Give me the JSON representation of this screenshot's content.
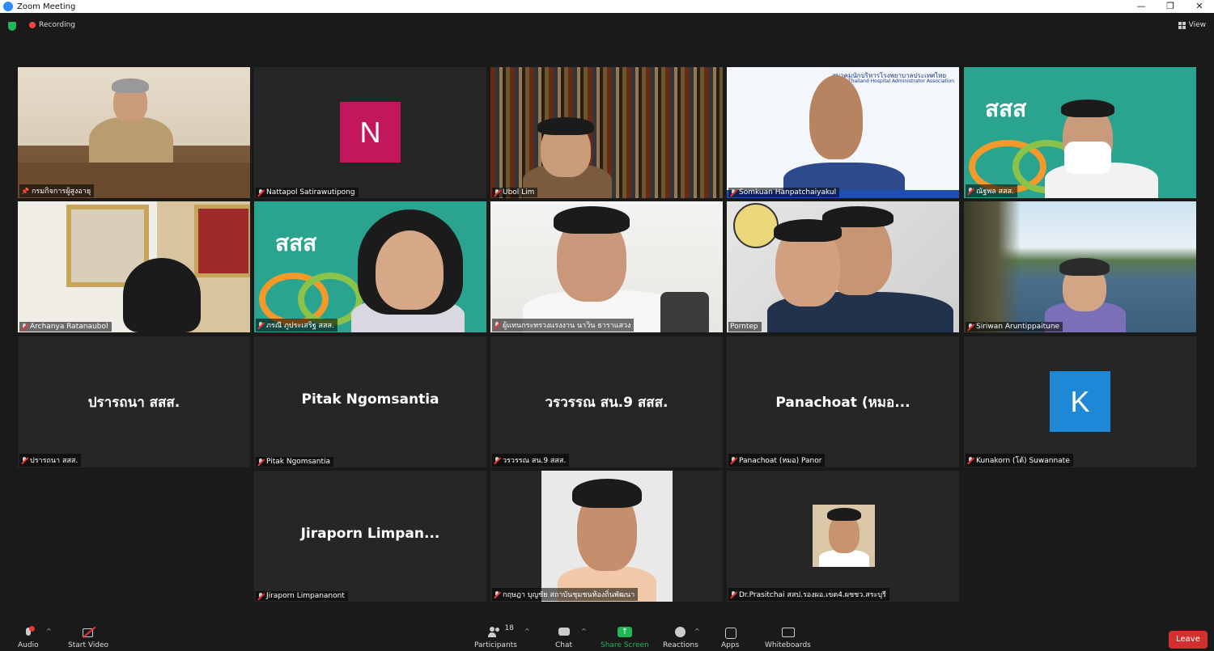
{
  "window": {
    "title": "Zoom Meeting",
    "minimize": "—",
    "restore": "❐",
    "close": "✕"
  },
  "topbar": {
    "recording": "Recording",
    "view": "View"
  },
  "tiles": [
    {
      "name": "กรมกิจการผู้สูงอายุ",
      "pinned": true
    },
    {
      "name": "Nattapol Satirawutipong",
      "initial": "N",
      "avatar_color": "#c2185b"
    },
    {
      "name": "Ubol Lim"
    },
    {
      "name": "Somkuan Hanpatchaiyakul",
      "bg_text": "สมาคมนักบริหารโรงพยาบาลประเทศไทย",
      "bg_text_en": "Thailand Hospital Administrator Association"
    },
    {
      "name": "ณัฐพล สสส.",
      "logo": "สสส"
    },
    {
      "name": "Archanya Ratanaubol"
    },
    {
      "name": "ภรณี ภูประเสริฐ สสส.",
      "logo": "สสส"
    },
    {
      "name": "ผู้แทนกระทรวงแรงงาน นาวิน ธาราแสวง"
    },
    {
      "name": "Porntep",
      "speaking": true
    },
    {
      "name": "Siriwan Aruntippaitune"
    },
    {
      "name": "ปรารถนา สสส.",
      "display": "ปรารถนา สสส."
    },
    {
      "name": "Pitak Ngomsantia",
      "display": "Pitak Ngomsantia"
    },
    {
      "name": "วรวรรณ สน.9 สสส.",
      "display": "วรวรรณ สน.9 สสส."
    },
    {
      "name": "Panachoat (หมอ) Panor",
      "display": "Panachoat  (หมอ..."
    },
    {
      "name": "Kunakorn (โต้) Suwannate",
      "initial": "K",
      "avatar_color": "#1e88d6"
    },
    {
      "name": "Jiraporn Limpananont",
      "display": "Jiraporn  Limpan..."
    },
    {
      "name": "กฤษฎา บุญชัย สถาบันชุมชนท้องถิ่นพัฒนา"
    },
    {
      "name": "Dr.Prasitchai สสป.รองผอ.เขต4.ผชชว.สระบุรี"
    }
  ],
  "toolbar": {
    "audio": "Audio",
    "start_video": "Start Video",
    "participants": "Participants",
    "participants_count": "18",
    "chat": "Chat",
    "share": "Share Screen",
    "reactions": "Reactions",
    "apps": "Apps",
    "whiteboards": "Whiteboards",
    "leave": "Leave"
  },
  "colors": {
    "share_green": "#1fb855",
    "leave_red": "#d32f2f",
    "speaking_border": "#c8e04a"
  }
}
